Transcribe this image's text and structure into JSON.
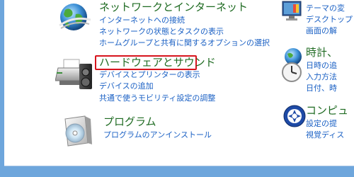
{
  "left_column": {
    "network": {
      "title": "ネットワークとインターネット",
      "links": [
        "インターネットへの接続",
        "ネットワークの状態とタスクの表示",
        "ホームグループと共有に関するオプションの選択"
      ]
    },
    "hardware": {
      "title": "ハードウェアとサウンド",
      "links": [
        "デバイスとプリンターの表示",
        "デバイスの追加",
        "共通で使うモビリティ設定の調整"
      ]
    },
    "programs": {
      "title": "プログラム",
      "links": [
        "プログラムのアンインストール"
      ]
    }
  },
  "right_column": {
    "appearance": {
      "links": [
        "テーマの変",
        "デスクトップ",
        "画面の解"
      ]
    },
    "clock": {
      "title": "時計、",
      "links": [
        "日時の追",
        "入力方法",
        "日付、時"
      ]
    },
    "ease": {
      "title": "コンピュ",
      "links": [
        "設定の提",
        "視覚ディス"
      ]
    }
  },
  "colors": {
    "category_title": "#1f6b22",
    "task_link": "#1a60c4",
    "highlight_border": "#d7141d",
    "desktop_background": "#6ea6dc"
  }
}
